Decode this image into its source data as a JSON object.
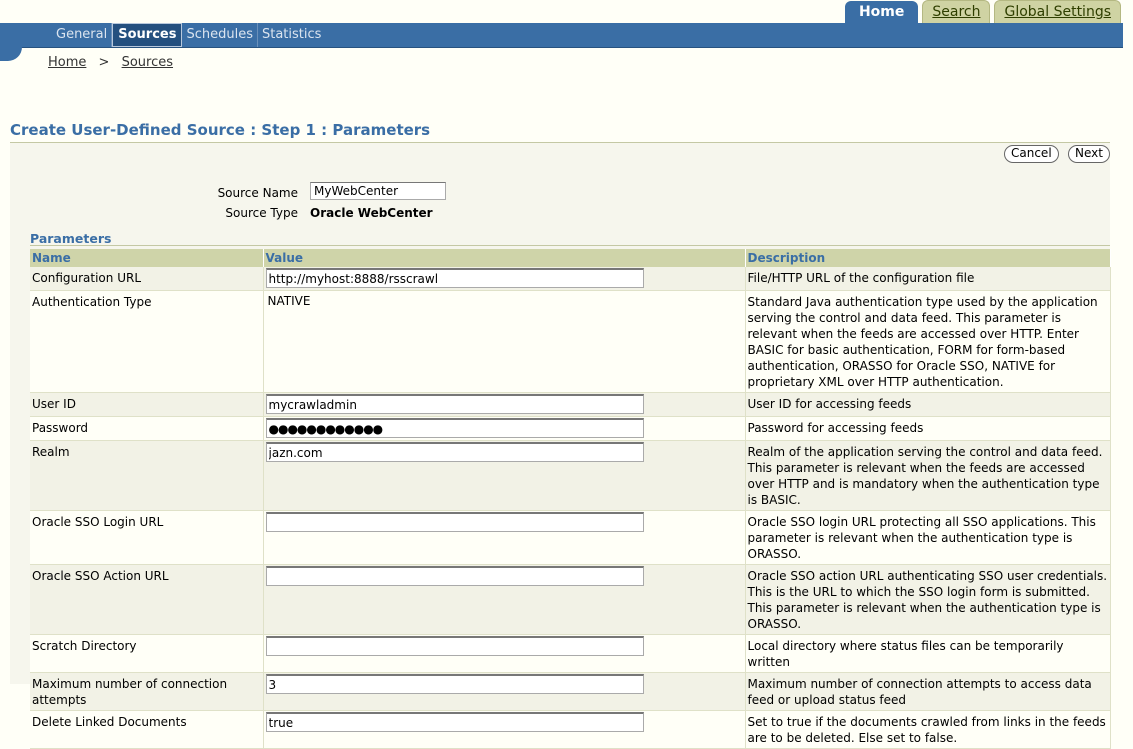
{
  "top_tabs": {
    "home": "Home",
    "search": "Search",
    "global_settings": "Global Settings"
  },
  "sub_tabs": {
    "general": "General",
    "sources": "Sources",
    "schedules": "Schedules",
    "statistics": "Statistics"
  },
  "breadcrumb": {
    "home": "Home",
    "separator": ">",
    "sources": "Sources"
  },
  "page": {
    "title": "Create User-Defined Source : Step 1 : Parameters"
  },
  "buttons": {
    "cancel": "Cancel",
    "next": "Next"
  },
  "source": {
    "name_label": "Source Name",
    "name_value": "MyWebCenter",
    "type_label": "Source Type",
    "type_value": "Oracle WebCenter"
  },
  "parameters": {
    "section_title": "Parameters",
    "headers": {
      "name": "Name",
      "value": "Value",
      "description": "Description"
    },
    "rows": [
      {
        "name": "Configuration URL",
        "value": "http://myhost:8888/rsscrawl",
        "description": "File/HTTP URL of the configuration file"
      },
      {
        "name": "Authentication Type",
        "value": "NATIVE",
        "description": "Standard Java authentication type used by the application serving the control and data feed. This parameter is relevant when the feeds are accessed over HTTP. Enter BASIC for basic authentication, FORM for form-based authentication, ORASSO for Oracle SSO, NATIVE for proprietary XML over HTTP authentication."
      },
      {
        "name": "User ID",
        "value": "mycrawladmin",
        "description": "User ID for accessing feeds"
      },
      {
        "name": "Password",
        "value": "●●●●●●●●●●●●",
        "description": "Password for accessing feeds"
      },
      {
        "name": "Realm",
        "value": "jazn.com",
        "description": "Realm of the application serving the control and data feed. This parameter is relevant when the feeds are accessed over HTTP and is mandatory when the authentication type is BASIC."
      },
      {
        "name": "Oracle SSO Login URL",
        "value": "",
        "description": "Oracle SSO login URL protecting all SSO applications. This parameter is relevant when the authentication type is ORASSO."
      },
      {
        "name": "Oracle SSO Action URL",
        "value": "",
        "description": "Oracle SSO action URL authenticating SSO user credentials. This is the URL to which the SSO login form is submitted. This parameter is relevant when the authentication type is ORASSO."
      },
      {
        "name": "Scratch Directory",
        "value": "",
        "description": "Local directory where status files can be temporarily written"
      },
      {
        "name": "Maximum number of connection attempts",
        "value": "3",
        "description": "Maximum number of connection attempts to access data feed or upload status feed"
      },
      {
        "name": "Delete Linked Documents",
        "value": "true",
        "description": "Set to true if the documents crawled from links in the feeds are to be deleted. Else set to false."
      }
    ]
  }
}
